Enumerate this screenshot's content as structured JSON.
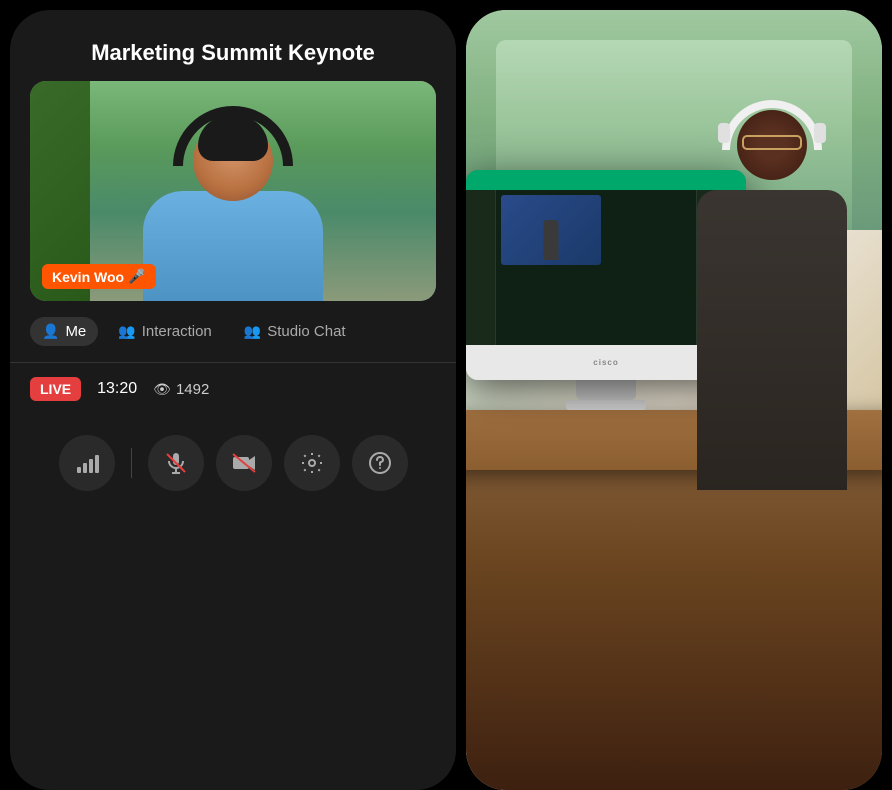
{
  "left_panel": {
    "title": "Marketing Summit Keynote",
    "video": {
      "presenter_name": "Kevin Woo",
      "presenter_mic_icon": "🎤"
    },
    "tabs": [
      {
        "id": "me",
        "label": "Me",
        "icon": "👤",
        "active": true
      },
      {
        "id": "interaction",
        "label": "Interaction",
        "icon": "👥",
        "active": false
      },
      {
        "id": "studio-chat",
        "label": "Studio Chat",
        "icon": "👥",
        "active": false
      }
    ],
    "status": {
      "live_label": "LIVE",
      "timer": "13:20",
      "viewers_icon": "👁",
      "viewers_count": "1492"
    },
    "controls": [
      {
        "id": "signal",
        "icon": "📶",
        "label": "signal-strength"
      },
      {
        "id": "mic-muted",
        "icon": "🎤",
        "label": "mute-mic",
        "muted": true
      },
      {
        "id": "camera-muted",
        "icon": "📷",
        "label": "mute-camera",
        "muted": true
      },
      {
        "id": "settings",
        "icon": "⚙",
        "label": "settings"
      },
      {
        "id": "help",
        "icon": "?",
        "label": "help"
      }
    ]
  },
  "colors": {
    "background": "#1a1a1a",
    "accent_red": "#e53e3e",
    "live_badge": "#e53e3e",
    "name_badge": "#ff5500",
    "tab_active": "#333333",
    "control_btn": "#2a2a2a"
  }
}
